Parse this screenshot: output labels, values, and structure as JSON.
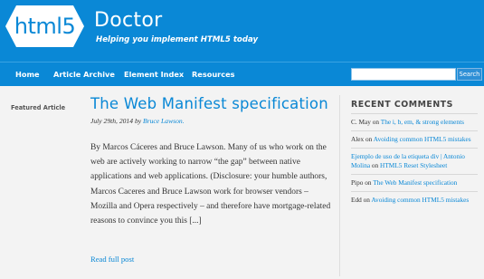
{
  "header": {
    "logo_text": "html5",
    "site_name": "Doctor",
    "tagline": "Helping you implement HTML5 today"
  },
  "nav": {
    "items": [
      {
        "label": "Home"
      },
      {
        "label": "Article Archive"
      },
      {
        "label": "Element Index"
      },
      {
        "label": "Resources"
      }
    ],
    "search": {
      "value": "",
      "button_label": "Search"
    }
  },
  "featured": {
    "label": "Featured Article",
    "title": "The Web Manifest specification",
    "date": "July 29th, 2014",
    "by": "by",
    "author": "Bruce Lawson.",
    "excerpt": "By Marcos Cáceres and Bruce Lawson. Many of us who work on the web are actively working to narrow “the gap” between native applications and web applications. (Disclosure: your humble authors, Marcos Caceres and Bruce Lawson work for browser vendors – Mozilla and Opera respectively – and therefore have mortgage-related reasons to convince you this [...]",
    "read_more": "Read full post"
  },
  "sidebar": {
    "title": "RECENT COMMENTS",
    "comments": [
      {
        "author": "C. May",
        "on": "on",
        "post": "The i, b, em, & strong elements"
      },
      {
        "author": "Alex",
        "on": "on",
        "post": "Avoiding common HTML5 mistakes"
      },
      {
        "author": "Ejemplo de uso de la etiqueta div | Antonio Molina",
        "on": "on",
        "post": "HTML5 Reset Stylesheet"
      },
      {
        "author": "Pipo",
        "on": "on",
        "post": "The Web Manifest specification"
      },
      {
        "author": "Edd",
        "on": "on",
        "post": "Avoiding common HTML5 mistakes"
      }
    ]
  },
  "colors": {
    "brand_blue": "#0a88d6",
    "background": "#f3f3f3"
  }
}
